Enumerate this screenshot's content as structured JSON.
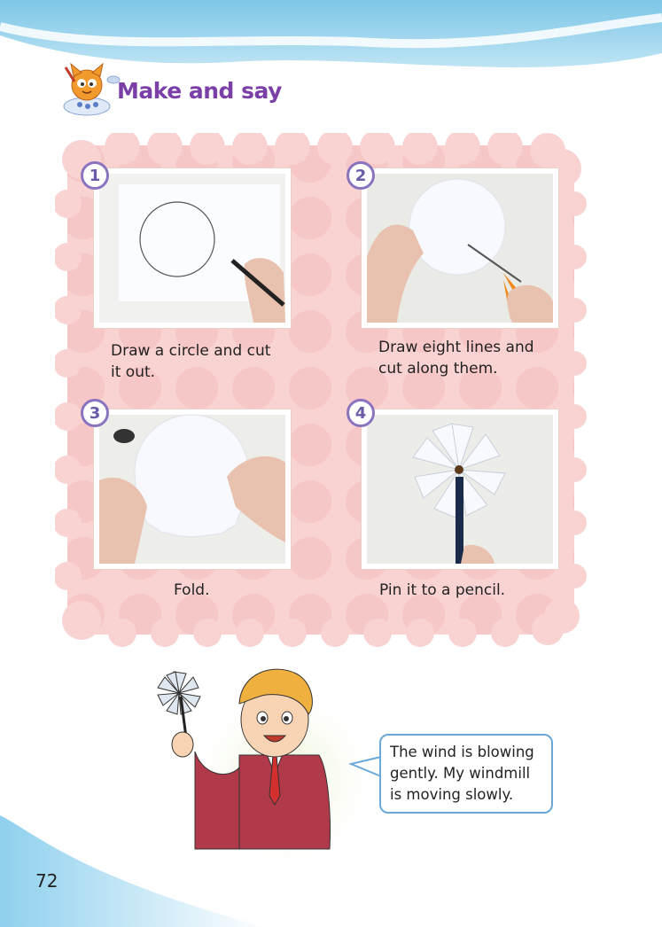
{
  "header": {
    "title": "Make and say"
  },
  "steps": [
    {
      "number": "1",
      "caption_lines": [
        "Draw a circle and cut",
        "it out."
      ]
    },
    {
      "number": "2",
      "caption_lines": [
        "Draw eight lines and",
        "cut along them."
      ]
    },
    {
      "number": "3",
      "caption_lines": [
        "Fold."
      ]
    },
    {
      "number": "4",
      "caption_lines": [
        "Pin it to a pencil."
      ]
    }
  ],
  "speech": {
    "lines": [
      "The wind is blowing",
      "gently. My windmill",
      "is moving slowly."
    ]
  },
  "page_number": "72",
  "colors": {
    "panel": "#f9cfd0",
    "dots": "#f6b9bb",
    "badge_border": "#8a74c0",
    "title": "#7b3fa8",
    "bubble_border": "#6aa8d8"
  }
}
